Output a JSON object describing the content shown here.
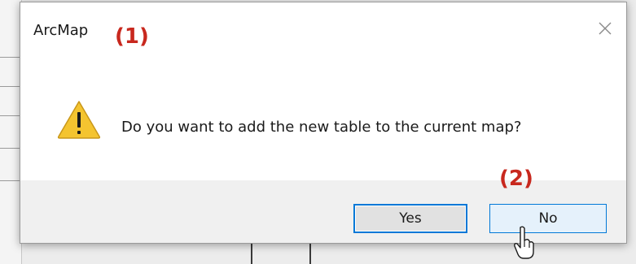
{
  "dialog": {
    "title": "ArcMap",
    "message": "Do you want to add the new table to the current map?",
    "close_icon": "close-icon",
    "warning_icon": "warning-icon"
  },
  "buttons": {
    "yes_label": "Yes",
    "no_label": "No"
  },
  "annotations": {
    "first": "(1)",
    "second": "(2)"
  },
  "colors": {
    "accent": "#0078d7",
    "annotation": "#c8281e",
    "warning_fill": "#f4c430"
  }
}
